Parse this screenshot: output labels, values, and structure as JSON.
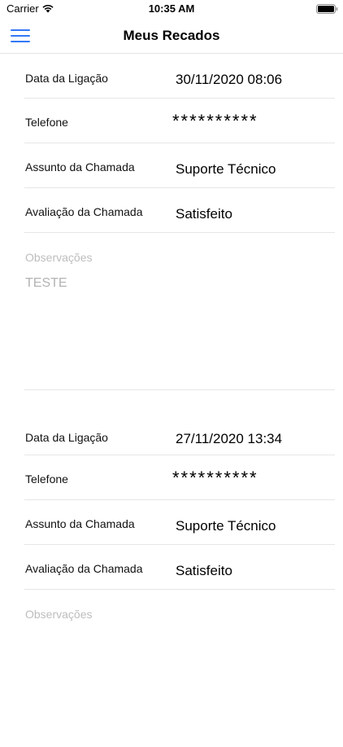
{
  "status_bar": {
    "carrier": "Carrier",
    "time": "10:35 AM"
  },
  "nav": {
    "title": "Meus Recados",
    "menu_icon": "hamburger-menu-icon",
    "accent_color": "#3478f6"
  },
  "records": [
    {
      "date_label": "Data da Ligação",
      "date_value": "30/11/2020 08:06",
      "phone_label": "Telefone",
      "phone_value": "**********",
      "subject_label": "Assunto da Chamada",
      "subject_value": "Suporte Técnico",
      "rating_label": "Avaliação da Chamada",
      "rating_value": "Satisfeito",
      "notes_label": "Observações",
      "notes_value": "TESTE"
    },
    {
      "date_label": "Data da Ligação",
      "date_value": "27/11/2020 13:34",
      "phone_label": "Telefone",
      "phone_value": "**********",
      "subject_label": "Assunto da Chamada",
      "subject_value": "Suporte Técnico",
      "rating_label": "Avaliação da Chamada",
      "rating_value": "Satisfeito",
      "notes_label": "Observações"
    }
  ]
}
